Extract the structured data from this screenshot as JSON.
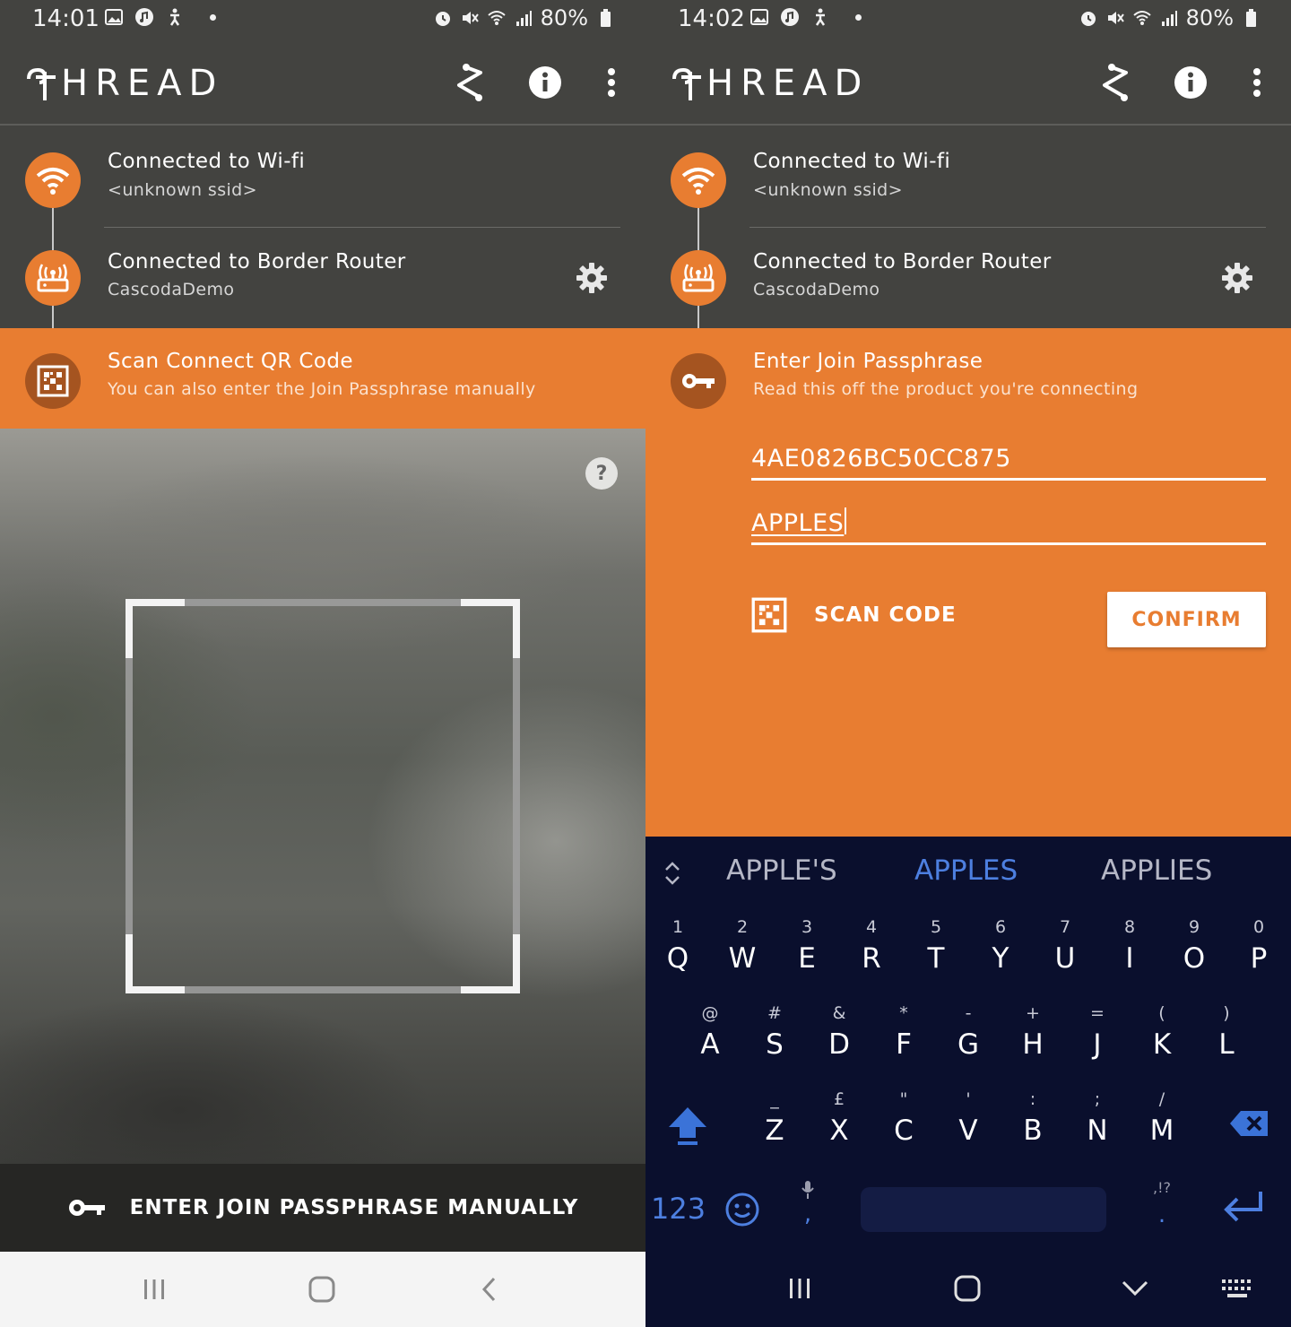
{
  "left": {
    "status": {
      "time": "14:01",
      "battery": "80%"
    },
    "app": {
      "logo_text": "HREAD"
    },
    "wifi": {
      "title": "Connected to Wi-fi",
      "subtitle": "<unknown ssid>"
    },
    "router": {
      "title": "Connected to Border Router",
      "subtitle": "CascodaDemo"
    },
    "step": {
      "title": "Scan Connect QR Code",
      "subtitle": "You can also enter the Join Passphrase manually"
    },
    "camera": {
      "help_icon": "?"
    },
    "manual_button": "ENTER JOIN PASSPHRASE MANUALLY"
  },
  "right": {
    "status": {
      "time": "14:02",
      "battery": "80%"
    },
    "app": {
      "logo_text": "HREAD"
    },
    "wifi": {
      "title": "Connected to Wi-fi",
      "subtitle": "<unknown ssid>"
    },
    "router": {
      "title": "Connected to Border Router",
      "subtitle": "CascodaDemo"
    },
    "step": {
      "title": "Enter Join Passphrase",
      "subtitle": "Read this off the product you're connecting"
    },
    "fields": {
      "eui": "4AE0826BC50CC875",
      "passphrase": "APPLES"
    },
    "scan_code_label": "SCAN CODE",
    "confirm_label": "CONFIRM",
    "keyboard": {
      "suggestions": [
        "APPLE'S",
        "APPLES",
        "APPLIES"
      ],
      "active_suggestion": "APPLES",
      "row1": [
        [
          "1",
          "Q"
        ],
        [
          "2",
          "W"
        ],
        [
          "3",
          "E"
        ],
        [
          "4",
          "R"
        ],
        [
          "5",
          "T"
        ],
        [
          "6",
          "Y"
        ],
        [
          "7",
          "U"
        ],
        [
          "8",
          "I"
        ],
        [
          "9",
          "O"
        ],
        [
          "0",
          "P"
        ]
      ],
      "row2": [
        [
          "@",
          "A"
        ],
        [
          "#",
          "S"
        ],
        [
          "&",
          "D"
        ],
        [
          "*",
          "F"
        ],
        [
          "-",
          "G"
        ],
        [
          "+",
          "H"
        ],
        [
          "=",
          "J"
        ],
        [
          "(",
          "K"
        ],
        [
          ")",
          "L"
        ]
      ],
      "row3": [
        [
          "_",
          "Z"
        ],
        [
          "£",
          "X"
        ],
        [
          "\"",
          "C"
        ],
        [
          "'",
          "V"
        ],
        [
          ":",
          "B"
        ],
        [
          ";",
          "N"
        ],
        [
          "/",
          "M"
        ]
      ],
      "symbols_key": "123",
      "comma_key": ",",
      "period_key": ".",
      "punct_hint": ",!?"
    }
  },
  "colors": {
    "accent": "#e87d31",
    "dark": "#434340",
    "keyboard_bg": "#0a0f2d",
    "suggestion_active": "#4d7fe0"
  }
}
